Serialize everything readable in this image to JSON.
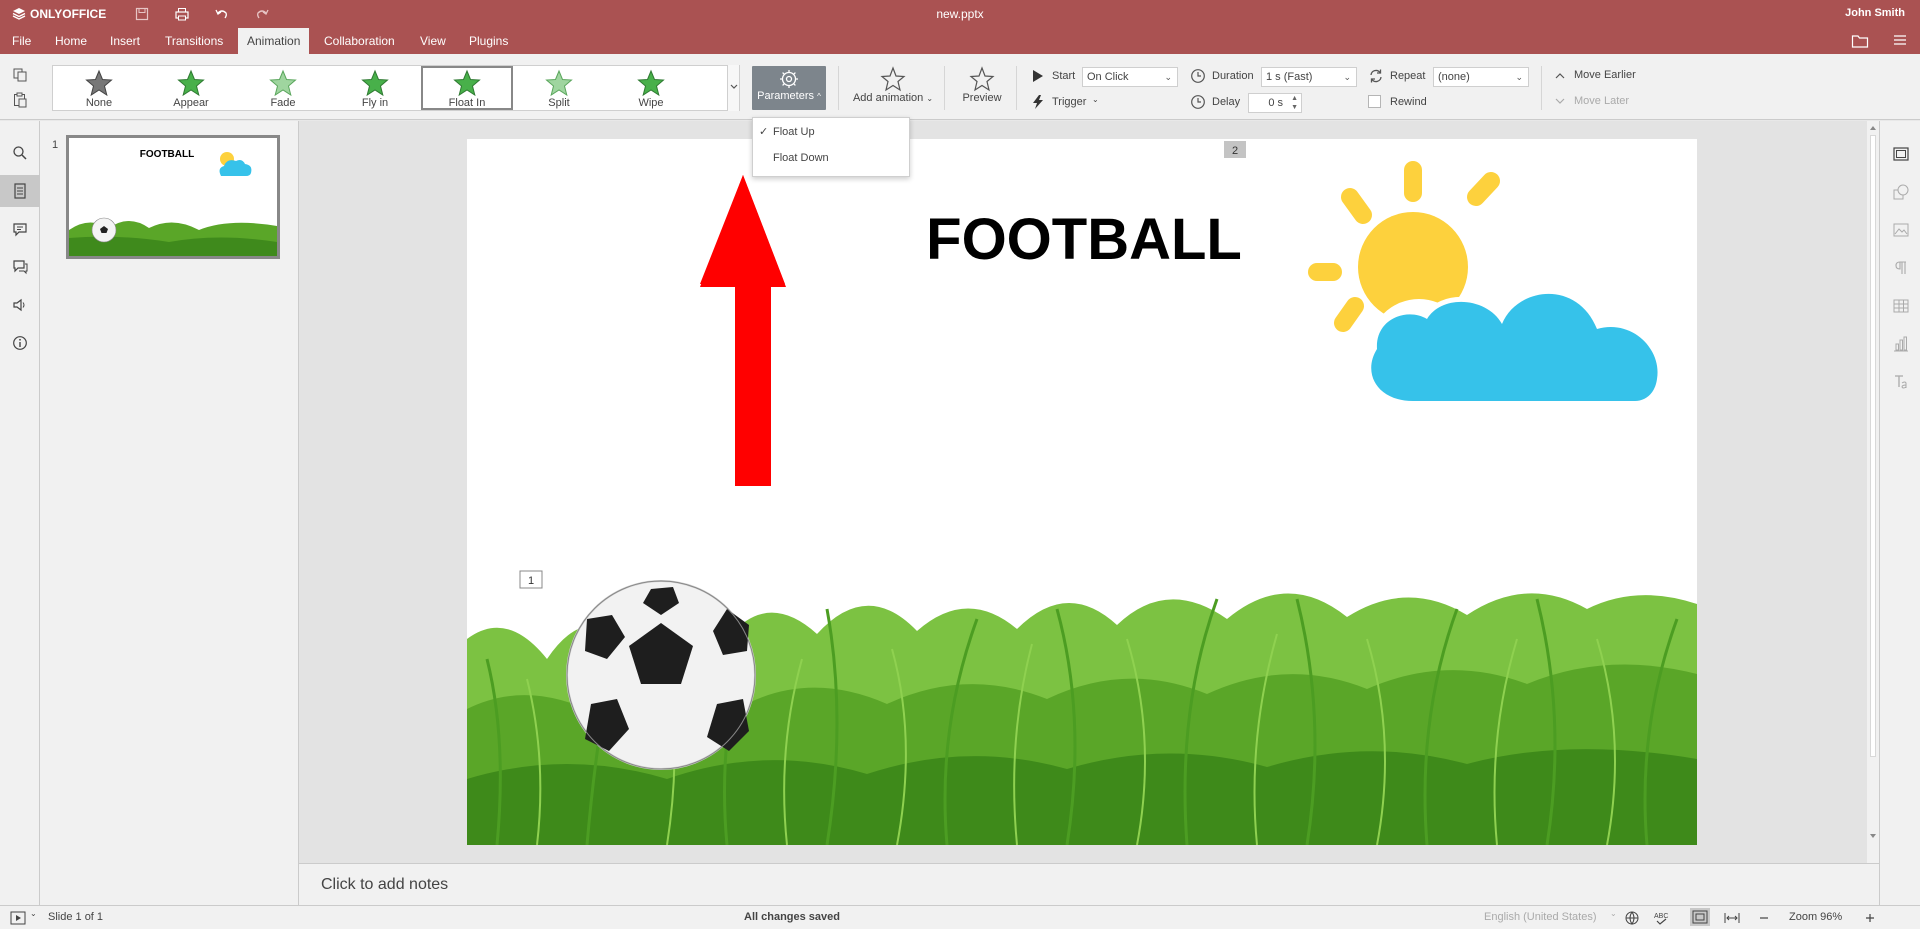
{
  "app": {
    "logo_text": "ONLYOFFICE",
    "doc_title": "new.pptx",
    "user_name": "John Smith"
  },
  "tabs": [
    {
      "label": "File"
    },
    {
      "label": "Home"
    },
    {
      "label": "Insert"
    },
    {
      "label": "Transitions"
    },
    {
      "label": "Animation",
      "active": true
    },
    {
      "label": "Collaboration"
    },
    {
      "label": "View"
    },
    {
      "label": "Plugins"
    }
  ],
  "animation_gallery": [
    {
      "label": "None",
      "icon": "star-gray-icon"
    },
    {
      "label": "Appear",
      "icon": "star-green-icon"
    },
    {
      "label": "Fade",
      "icon": "star-green-light-icon"
    },
    {
      "label": "Fly in",
      "icon": "star-green-icon"
    },
    {
      "label": "Float In",
      "icon": "star-green-icon",
      "selected": true
    },
    {
      "label": "Split",
      "icon": "star-green-light-icon"
    },
    {
      "label": "Wipe",
      "icon": "star-green-icon"
    }
  ],
  "toolbar": {
    "parameters_label": "Parameters",
    "add_animation_label": "Add animation",
    "preview_label": "Preview",
    "start_label": "Start",
    "start_value": "On Click",
    "trigger_label": "Trigger",
    "duration_label": "Duration",
    "duration_value": "1 s (Fast)",
    "delay_label": "Delay",
    "delay_value": "0 s",
    "repeat_label": "Repeat",
    "repeat_value": "(none)",
    "rewind_label": "Rewind",
    "move_earlier_label": "Move Earlier",
    "move_later_label": "Move Later"
  },
  "parameters_menu": [
    {
      "label": "Float Up",
      "checked": true
    },
    {
      "label": "Float Down",
      "checked": false
    }
  ],
  "thumbnails": {
    "slide_number": "1",
    "title": "FOOTBALL"
  },
  "slide": {
    "title": "FOOTBALL",
    "anim_tag_1": "1",
    "anim_tag_2": "2"
  },
  "notes": {
    "placeholder": "Click to add notes"
  },
  "statusbar": {
    "slide_info": "Slide 1 of 1",
    "save_status": "All changes saved",
    "language": "English (United States)",
    "zoom": "Zoom 96%"
  },
  "colors": {
    "accent": "#aa5252",
    "arrow": "#ff0000",
    "sun": "#fdd13d",
    "cloud": "#36c2ea",
    "grass": "#5aa628"
  }
}
